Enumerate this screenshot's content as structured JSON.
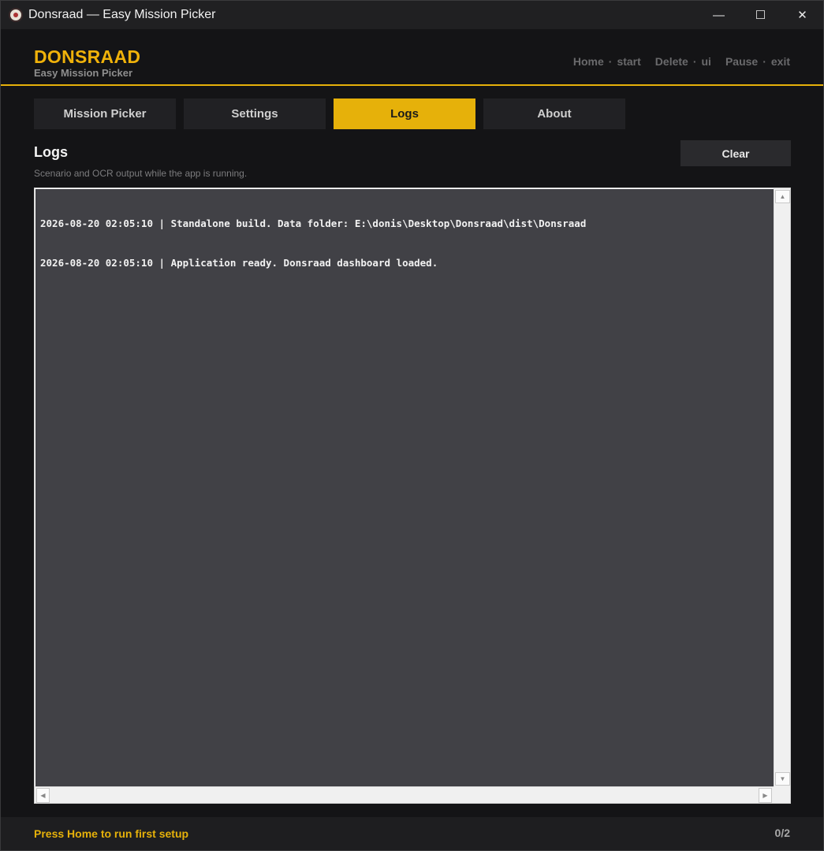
{
  "window": {
    "title": "Donsraad — Easy Mission Picker",
    "controls": {
      "minimize": "—",
      "maximize": "☐",
      "close": "✕"
    }
  },
  "header": {
    "brand": "DONSRAAD",
    "subtitle": "Easy Mission Picker",
    "hotkeys": [
      {
        "key": "Home",
        "action": "start"
      },
      {
        "key": "Delete",
        "action": "ui"
      },
      {
        "key": "Pause",
        "action": "exit"
      }
    ],
    "accent_color": "#e6b10a"
  },
  "tabs": [
    {
      "label": "Mission Picker",
      "active": false
    },
    {
      "label": "Settings",
      "active": false
    },
    {
      "label": "Logs",
      "active": true
    },
    {
      "label": "About",
      "active": false
    }
  ],
  "logs": {
    "title": "Logs",
    "subtitle": "Scenario and OCR output while the app is running.",
    "clear_label": "Clear",
    "lines": [
      "2026-08-20 02:05:10 | Standalone build. Data folder: E:\\donis\\Desktop\\Donsraad\\dist\\Donsraad",
      "2026-08-20 02:05:10 | Application ready. Donsraad dashboard loaded."
    ]
  },
  "footer": {
    "status": "Press Home to run first setup",
    "counter": "0/2"
  }
}
